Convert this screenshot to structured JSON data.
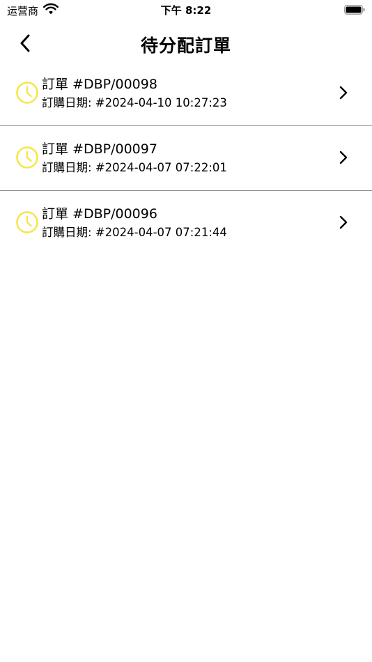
{
  "status_bar": {
    "carrier": "运营商",
    "time": "下午 8:22"
  },
  "header": {
    "title": "待分配訂單",
    "back_icon": "chevron-left-icon"
  },
  "colors": {
    "accent_clock": "#f4e64b",
    "divider": "#8e8e8e"
  },
  "orders": [
    {
      "title": "訂單 #DBP/00098",
      "date": "訂購日期: #2024-04-10 10:27:23",
      "icon": "clock-icon"
    },
    {
      "title": "訂單 #DBP/00097",
      "date": "訂購日期: #2024-04-07 07:22:01",
      "icon": "clock-icon"
    },
    {
      "title": "訂單 #DBP/00096",
      "date": "訂購日期: #2024-04-07 07:21:44",
      "icon": "clock-icon"
    }
  ]
}
